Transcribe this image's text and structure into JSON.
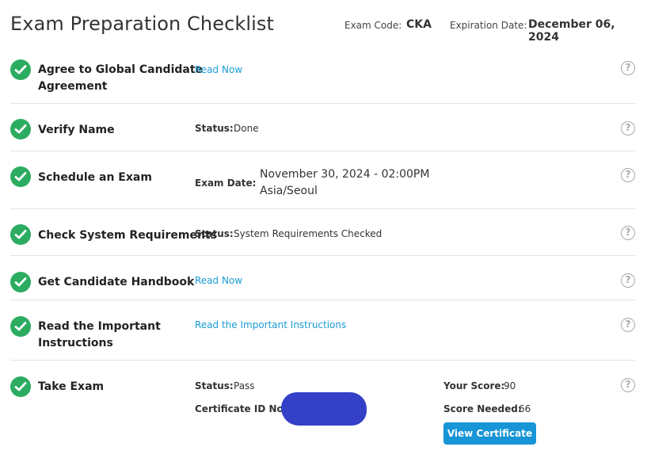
{
  "header": {
    "title": "Exam Preparation Checklist",
    "exam_code_label": "Exam Code:",
    "exam_code_value": "CKA",
    "expiration_label": "Expiration Date:",
    "expiration_value": "December 06, 2024"
  },
  "steps": [
    {
      "title_line1": "Agree to Global Candidate",
      "title_line2": "Agreement",
      "link": "Read Now"
    },
    {
      "title": "Verify Name",
      "status_label": "Status:",
      "status_value": "Done"
    },
    {
      "title": "Schedule an Exam",
      "date_label": "Exam Date:",
      "date_value": "November 30, 2024 - 02:00PM",
      "timezone": "Asia/Seoul"
    },
    {
      "title": "Check System Requirements",
      "status_label": "Status:",
      "status_value": "System Requirements Checked"
    },
    {
      "title": "Get Candidate Handbook",
      "link": "Read Now"
    },
    {
      "title_line1": "Read the Important",
      "title_line2": "Instructions",
      "link": "Read the Important Instructions"
    },
    {
      "title": "Take Exam",
      "status_label": "Status:",
      "status_value": "Pass",
      "cert_label": "Certificate ID No.:",
      "score_label": "Your Score:",
      "score_value": "90",
      "needed_label": "Score Needed:",
      "needed_value": "66",
      "button": "View Certificate"
    }
  ],
  "help_glyph": "?",
  "icons": {
    "check": "check-circle-icon",
    "help": "question-circle-icon"
  },
  "colors": {
    "check": "#2cac61",
    "link": "#1a9bd7",
    "button": "#1795d6",
    "redaction": "#3340c7"
  }
}
